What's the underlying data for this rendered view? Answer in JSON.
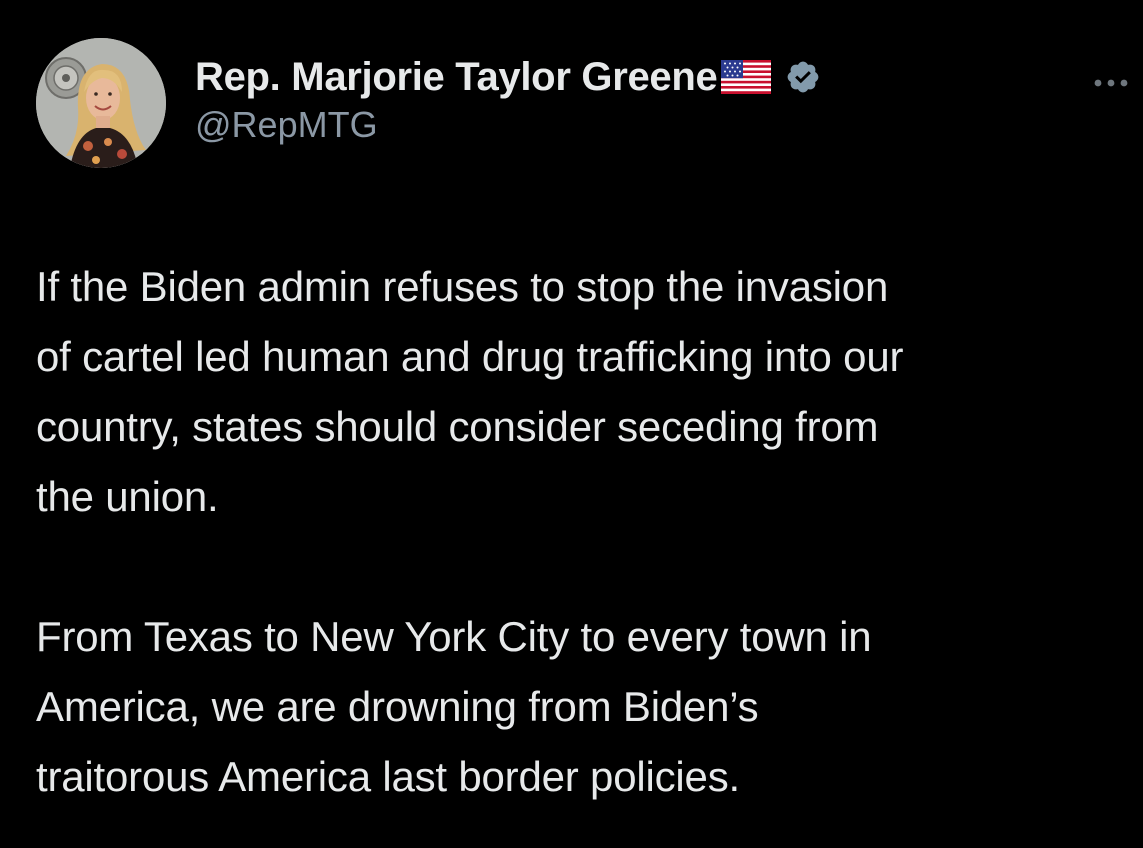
{
  "tweet": {
    "author": {
      "display_name": "Rep. Marjorie Taylor Greene",
      "handle": "@RepMTG",
      "flag_icon": "us-flag-emoji",
      "verified_icon": "verified-badge-icon",
      "verified_color": "#829aab"
    },
    "more_icon": "more-options-icon",
    "paragraphs": [
      "If the Biden admin refuses to stop the invasion\nof cartel led human and drug trafficking into our\ncountry, states should consider seceding from\nthe union.",
      "From Texas to New York City to every town in\nAmerica, we are drowning from Biden’s\ntraitorous America last border policies."
    ]
  },
  "colors": {
    "background": "#000000",
    "text_primary": "#e7e9ea",
    "text_secondary": "#8b98a5"
  }
}
